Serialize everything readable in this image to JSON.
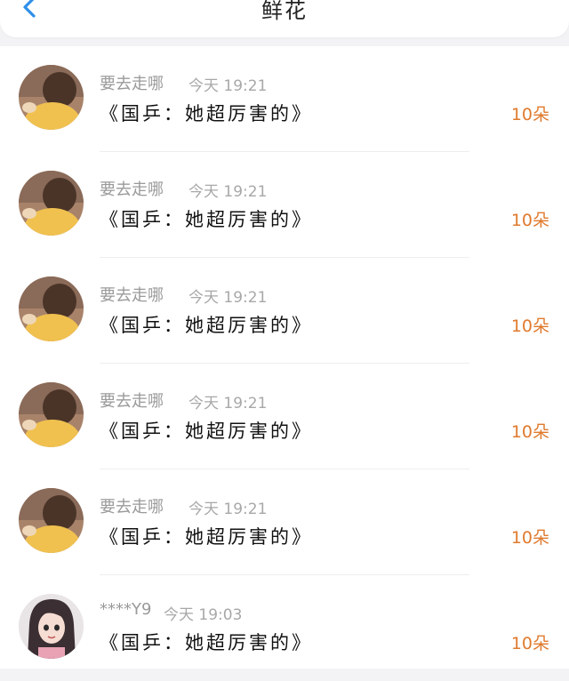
{
  "header": {
    "title": "鲜花",
    "back_icon": "chevron-left-icon",
    "accent_color": "#2f8fe8"
  },
  "records": [
    {
      "user": "要去走哪",
      "time": "今天 19:21",
      "message": "《国乒：她超厉害的》",
      "count": "10朵",
      "avatar": "child-photo"
    },
    {
      "user": "要去走哪",
      "time": "今天 19:21",
      "message": "《国乒：她超厉害的》",
      "count": "10朵",
      "avatar": "child-photo"
    },
    {
      "user": "要去走哪",
      "time": "今天 19:21",
      "message": "《国乒：她超厉害的》",
      "count": "10朵",
      "avatar": "child-photo"
    },
    {
      "user": "要去走哪",
      "time": "今天 19:21",
      "message": "《国乒：她超厉害的》",
      "count": "10朵",
      "avatar": "child-photo"
    },
    {
      "user": "要去走哪",
      "time": "今天 19:21",
      "message": "《国乒：她超厉害的》",
      "count": "10朵",
      "avatar": "child-photo"
    },
    {
      "user": "****Y9",
      "time": "今天 19:03",
      "message": "《国乒：她超厉害的》",
      "count": "10朵",
      "avatar": "anime-girl"
    }
  ],
  "colors": {
    "count": "#e07a2e",
    "name": "#9a9a9a",
    "time": "#a8a8a8"
  }
}
